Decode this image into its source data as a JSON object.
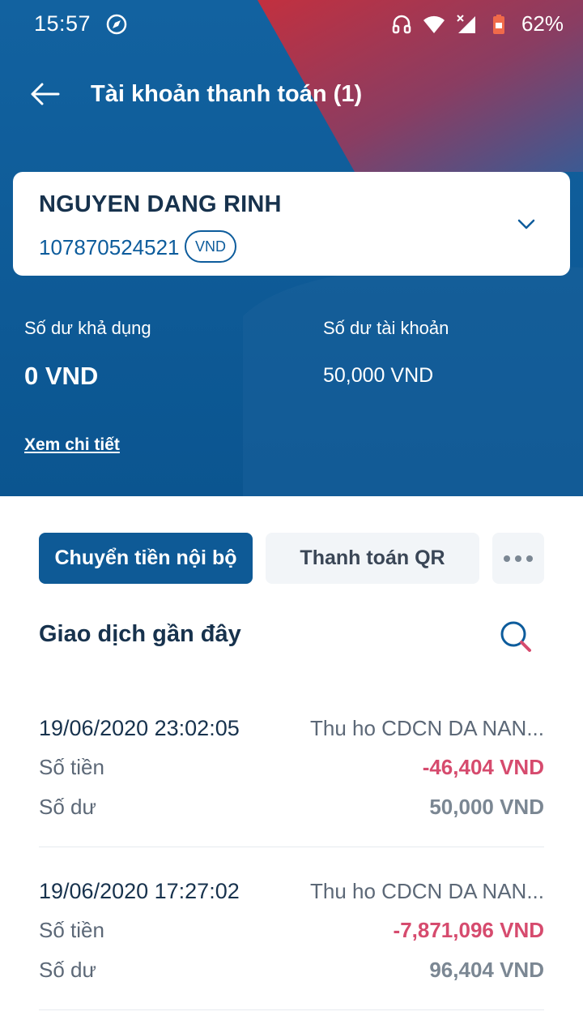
{
  "status_bar": {
    "time": "15:57",
    "battery": "62%"
  },
  "colors": {
    "primary": "#0e5a96",
    "accent_red": "#b8314a",
    "negative_amount": "#d64b6e",
    "dark_text": "#17324d",
    "muted_text": "#5c6877"
  },
  "header": {
    "title": "Tài khoản thanh toán (1)"
  },
  "account": {
    "name": "NGUYEN DANG RINH",
    "number": "107870524521",
    "currency": "VND"
  },
  "balances": {
    "available_label": "Số dư khả dụng",
    "available_value": "0 VND",
    "account_label": "Số dư tài khoản",
    "account_value": "50,000 VND",
    "detail_link": "Xem chi tiết"
  },
  "actions": {
    "internal_transfer": "Chuyển tiền nội bộ",
    "qr_payment": "Thanh toán QR",
    "more_icon": "more-horizontal-icon"
  },
  "transactions": {
    "title": "Giao dịch gần đây",
    "items": [
      {
        "datetime": "19/06/2020 23:02:05",
        "description": "Thu ho CDCN DA NAN...",
        "amount_label": "Số tiền",
        "amount": "-46,404 VND",
        "balance_label": "Số dư",
        "balance": "50,000 VND"
      },
      {
        "datetime": "19/06/2020 17:27:02",
        "description": "Thu ho CDCN DA NAN...",
        "amount_label": "Số tiền",
        "amount": "-7,871,096 VND",
        "balance_label": "Số dư",
        "balance": "96,404 VND"
      }
    ]
  }
}
